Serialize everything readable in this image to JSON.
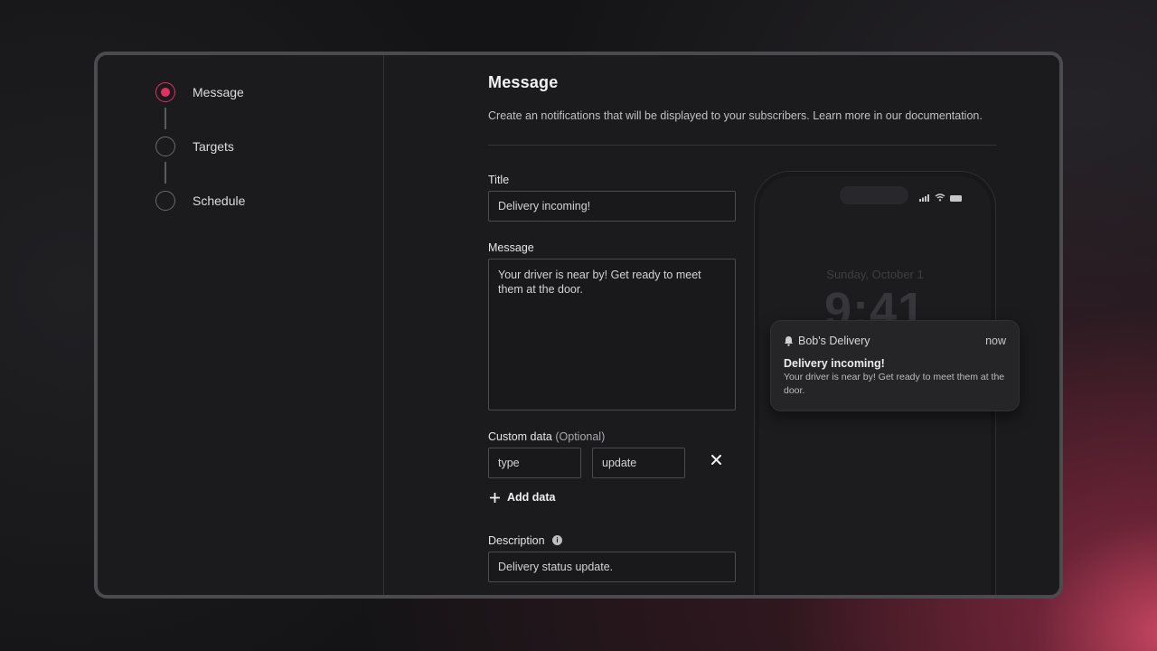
{
  "steps": [
    {
      "label": "Message",
      "active": true
    },
    {
      "label": "Targets",
      "active": false
    },
    {
      "label": "Schedule",
      "active": false
    }
  ],
  "main": {
    "title": "Message",
    "description": "Create an notifications that will be displayed to your subscribers. Learn more in our documentation."
  },
  "form": {
    "title_label": "Title",
    "title_value": "Delivery incoming!",
    "message_label": "Message",
    "message_value": "Your driver is near by! Get ready to meet them at the door.",
    "custom_data_label": "Custom data",
    "custom_data_optional": "(Optional)",
    "custom_data_key": "type",
    "custom_data_value": "update",
    "add_data_label": "Add data",
    "description_label": "Description",
    "description_value": "Delivery status update."
  },
  "preview": {
    "lock_date": "Sunday, October 1",
    "lock_time": "9:41",
    "notification": {
      "app_name": "Bob's Delivery",
      "time": "now",
      "title": "Delivery incoming!",
      "body": "Your driver is near by! Get ready to meet them at the door."
    }
  },
  "colors": {
    "accent": "#e0325f",
    "window_bg": "#1b1b1e"
  },
  "icons": {
    "remove": "close-icon",
    "add": "plus-icon",
    "info": "info-icon",
    "bell": "bell-icon"
  }
}
